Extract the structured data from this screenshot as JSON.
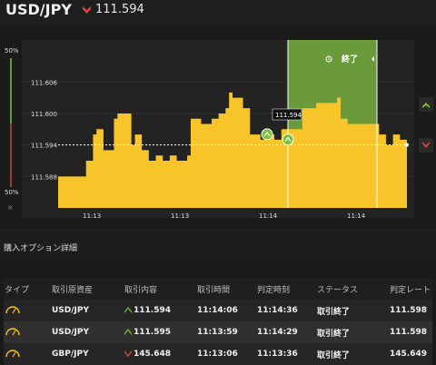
{
  "header": {
    "pair": "USD/JPY",
    "direction_icon": "down-arrow-icon",
    "price": "111.594"
  },
  "gauge": {
    "top_label": "50%",
    "bottom_label": "50%",
    "close_label": "×"
  },
  "chart": {
    "y_ticks": [
      "111.606",
      "111.600",
      "111.594",
      "111.588"
    ],
    "x_ticks": [
      "11:13",
      "11:13",
      "11:14",
      "11:14"
    ],
    "current_price_tag": "111.594",
    "end_button_label": "終了",
    "colors": {
      "area": "#f7c429",
      "green_zone": "#6a9a3a",
      "bg": "#232323"
    }
  },
  "chart_data": {
    "type": "area",
    "yticks": [
      111.606,
      111.6,
      111.594,
      111.588
    ],
    "ylim": [
      111.582,
      111.614
    ],
    "points": [
      [
        0,
        111.588
      ],
      [
        4,
        111.588
      ],
      [
        8,
        111.591
      ],
      [
        10,
        111.596
      ],
      [
        11,
        111.597
      ],
      [
        13,
        111.593
      ],
      [
        15,
        111.593
      ],
      [
        16,
        111.599
      ],
      [
        17,
        111.6
      ],
      [
        19,
        111.6
      ],
      [
        21,
        111.594
      ],
      [
        22,
        111.596
      ],
      [
        24,
        111.593
      ],
      [
        26,
        111.591
      ],
      [
        28,
        111.592
      ],
      [
        30,
        111.591
      ],
      [
        32,
        111.592
      ],
      [
        34,
        111.591
      ],
      [
        37,
        111.592
      ],
      [
        38,
        111.599
      ],
      [
        41,
        111.598
      ],
      [
        44,
        111.599
      ],
      [
        46,
        111.6
      ],
      [
        48,
        111.601
      ],
      [
        49,
        111.604
      ],
      [
        50,
        111.603
      ],
      [
        52,
        111.603
      ],
      [
        53,
        111.601
      ],
      [
        55,
        111.596
      ],
      [
        56,
        111.596
      ],
      [
        58,
        111.595
      ],
      [
        60,
        111.596
      ],
      [
        62,
        111.595
      ],
      [
        64,
        111.597
      ],
      [
        66,
        111.597
      ],
      [
        70,
        111.601
      ],
      [
        74,
        111.602
      ],
      [
        78,
        111.602
      ],
      [
        80,
        111.603
      ],
      [
        81,
        111.599
      ],
      [
        83,
        111.598
      ],
      [
        86,
        111.598
      ],
      [
        90,
        111.598
      ],
      [
        92,
        111.596
      ],
      [
        94,
        111.594
      ],
      [
        96,
        111.596
      ],
      [
        98,
        111.595
      ],
      [
        100,
        111.595
      ]
    ],
    "current_price": 111.594,
    "entry_points": [
      111.595,
      111.594
    ],
    "legend": "none"
  },
  "section": {
    "title": "購入オプション詳細"
  },
  "table": {
    "headers": [
      "タイプ",
      "取引原資産",
      "取引内容",
      "取引時間",
      "判定時刻",
      "ステータス",
      "判定レート"
    ],
    "rows": [
      {
        "asset": "USD/JPY",
        "direction": "up",
        "content": "111.594",
        "trade_time": "11:14:06",
        "judge_time": "11:14:36",
        "status": "取引終了",
        "rate": "111.598"
      },
      {
        "asset": "USD/JPY",
        "direction": "up",
        "content": "111.595",
        "trade_time": "11:13:59",
        "judge_time": "11:14:29",
        "status": "取引終了",
        "rate": "111.598"
      },
      {
        "asset": "GBP/JPY",
        "direction": "down",
        "content": "145.648",
        "trade_time": "11:13:06",
        "judge_time": "11:13:36",
        "status": "取引終了",
        "rate": "145.649"
      }
    ]
  }
}
